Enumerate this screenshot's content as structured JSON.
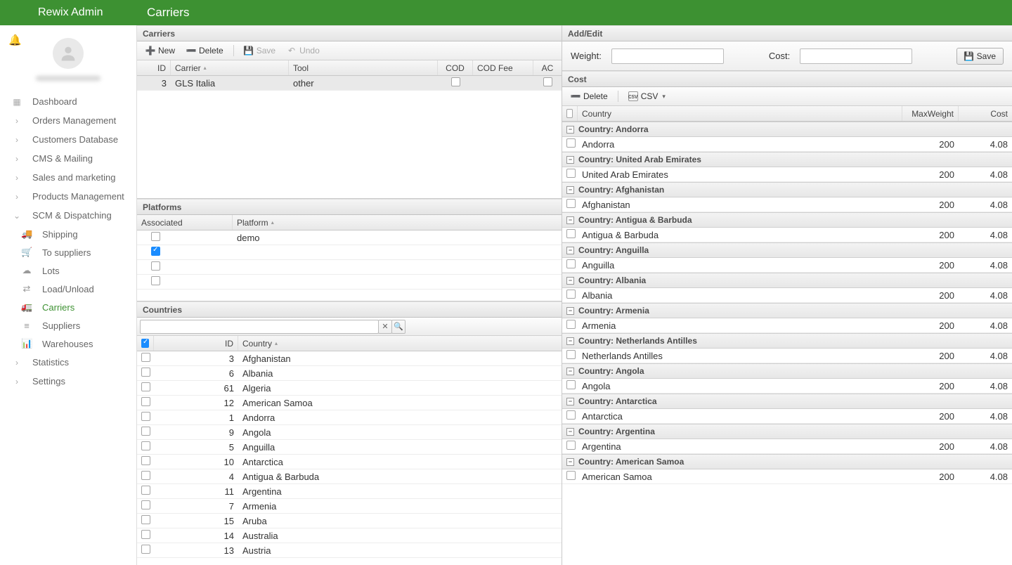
{
  "app_name": "Rewix Admin",
  "page_title": "Carriers",
  "user_email": "louie@zero1.it",
  "nav": [
    {
      "label": "Dashboard",
      "type": "top",
      "icon": "▦"
    },
    {
      "label": "Orders Management",
      "type": "top",
      "icon": "›"
    },
    {
      "label": "Customers Database",
      "type": "top",
      "icon": "›"
    },
    {
      "label": "CMS & Mailing",
      "type": "top",
      "icon": "›"
    },
    {
      "label": "Sales and marketing",
      "type": "top",
      "icon": "›"
    },
    {
      "label": "Products Management",
      "type": "top",
      "icon": "›"
    },
    {
      "label": "SCM & Dispatching",
      "type": "top",
      "icon": "⌄"
    },
    {
      "label": "Shipping",
      "type": "sub",
      "icon": "🚚"
    },
    {
      "label": "To suppliers",
      "type": "sub",
      "icon": "🛒"
    },
    {
      "label": "Lots",
      "type": "sub",
      "icon": "☁"
    },
    {
      "label": "Load/Unload",
      "type": "sub",
      "icon": "⇄"
    },
    {
      "label": "Carriers",
      "type": "sub",
      "icon": "🚛",
      "active": true
    },
    {
      "label": "Suppliers",
      "type": "sub",
      "icon": "≡"
    },
    {
      "label": "Warehouses",
      "type": "sub",
      "icon": "📊"
    },
    {
      "label": "Statistics",
      "type": "top",
      "icon": "›"
    },
    {
      "label": "Settings",
      "type": "top",
      "icon": "›"
    }
  ],
  "carriers": {
    "title": "Carriers",
    "toolbar": {
      "new": "New",
      "delete": "Delete",
      "save": "Save",
      "undo": "Undo"
    },
    "columns": {
      "id": "ID",
      "carrier": "Carrier",
      "tool": "Tool",
      "cod": "COD",
      "codfee": "COD Fee",
      "ac": "AC"
    },
    "rows": [
      {
        "id": "3",
        "carrier": "GLS Italia",
        "tool": "other",
        "cod": false,
        "ac": false
      }
    ]
  },
  "platforms": {
    "title": "Platforms",
    "columns": {
      "associated": "Associated",
      "platform": "Platform"
    },
    "rows": [
      {
        "associated": false,
        "platform": "demo"
      },
      {
        "associated": true,
        "platform": ""
      },
      {
        "associated": false,
        "platform": ""
      },
      {
        "associated": false,
        "platform": ""
      }
    ]
  },
  "countries": {
    "title": "Countries",
    "header_checked": true,
    "columns": {
      "id": "ID",
      "country": "Country"
    },
    "rows": [
      {
        "id": "3",
        "name": "Afghanistan"
      },
      {
        "id": "6",
        "name": "Albania"
      },
      {
        "id": "61",
        "name": "Algeria"
      },
      {
        "id": "12",
        "name": "American Samoa"
      },
      {
        "id": "1",
        "name": "Andorra"
      },
      {
        "id": "9",
        "name": "Angola"
      },
      {
        "id": "5",
        "name": "Anguilla"
      },
      {
        "id": "10",
        "name": "Antarctica"
      },
      {
        "id": "4",
        "name": "Antigua & Barbuda"
      },
      {
        "id": "11",
        "name": "Argentina"
      },
      {
        "id": "7",
        "name": "Armenia"
      },
      {
        "id": "15",
        "name": "Aruba"
      },
      {
        "id": "14",
        "name": "Australia"
      },
      {
        "id": "13",
        "name": "Austria"
      }
    ]
  },
  "addedit": {
    "title": "Add/Edit",
    "weight_label": "Weight:",
    "cost_label": "Cost:",
    "save": "Save"
  },
  "cost": {
    "title": "Cost",
    "toolbar": {
      "delete": "Delete",
      "csv": "CSV"
    },
    "columns": {
      "country": "Country",
      "maxweight": "MaxWeight",
      "cost": "Cost"
    },
    "group_prefix": "Country: ",
    "groups": [
      {
        "name": "Andorra",
        "rows": [
          {
            "country": "Andorra",
            "mw": "200",
            "cost": "4.08"
          }
        ]
      },
      {
        "name": "United Arab Emirates",
        "rows": [
          {
            "country": "United Arab Emirates",
            "mw": "200",
            "cost": "4.08"
          }
        ]
      },
      {
        "name": "Afghanistan",
        "rows": [
          {
            "country": "Afghanistan",
            "mw": "200",
            "cost": "4.08"
          }
        ]
      },
      {
        "name": "Antigua & Barbuda",
        "rows": [
          {
            "country": "Antigua & Barbuda",
            "mw": "200",
            "cost": "4.08"
          }
        ]
      },
      {
        "name": "Anguilla",
        "rows": [
          {
            "country": "Anguilla",
            "mw": "200",
            "cost": "4.08"
          }
        ]
      },
      {
        "name": "Albania",
        "rows": [
          {
            "country": "Albania",
            "mw": "200",
            "cost": "4.08"
          }
        ]
      },
      {
        "name": "Armenia",
        "rows": [
          {
            "country": "Armenia",
            "mw": "200",
            "cost": "4.08"
          }
        ]
      },
      {
        "name": "Netherlands Antilles",
        "rows": [
          {
            "country": "Netherlands Antilles",
            "mw": "200",
            "cost": "4.08"
          }
        ]
      },
      {
        "name": "Angola",
        "rows": [
          {
            "country": "Angola",
            "mw": "200",
            "cost": "4.08"
          }
        ]
      },
      {
        "name": "Antarctica",
        "rows": [
          {
            "country": "Antarctica",
            "mw": "200",
            "cost": "4.08"
          }
        ]
      },
      {
        "name": "Argentina",
        "rows": [
          {
            "country": "Argentina",
            "mw": "200",
            "cost": "4.08"
          }
        ]
      },
      {
        "name": "American Samoa",
        "rows": [
          {
            "country": "American Samoa",
            "mw": "200",
            "cost": "4.08"
          }
        ]
      }
    ]
  }
}
